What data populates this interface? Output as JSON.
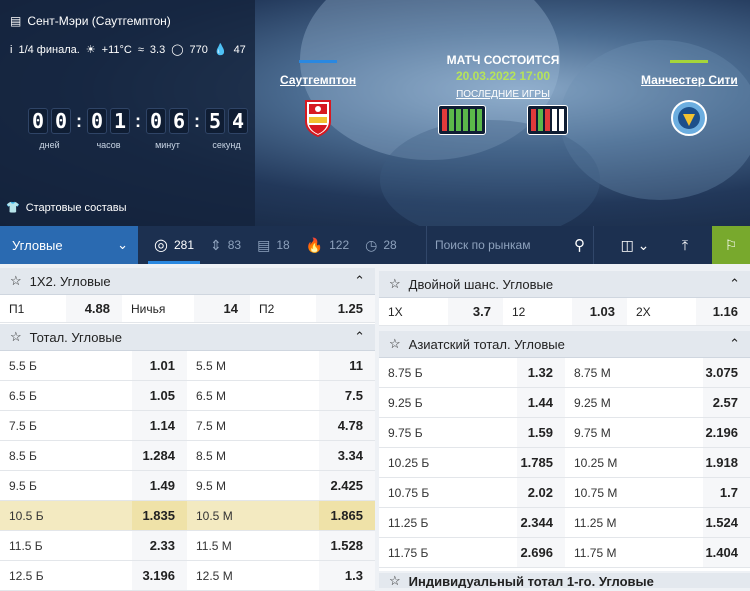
{
  "hero": {
    "venue": "Сент-Мэри (Саутгемптон)",
    "stage": "1/4 финала.",
    "temperature": "+11°C",
    "wind": "3.3",
    "attendance": "770",
    "humidity": "47",
    "countdown": {
      "days": [
        "0",
        "0"
      ],
      "hours": [
        "0",
        "1"
      ],
      "minutes": [
        "0",
        "6"
      ],
      "seconds": [
        "5",
        "4"
      ],
      "labels": {
        "days": "дней",
        "hours": "часов",
        "minutes": "минут",
        "seconds": "секунд"
      }
    },
    "lineups": "Стартовые составы",
    "home": {
      "name": "Саутгемптон",
      "bar_color": "#2a88e0"
    },
    "away": {
      "name": "Манчестер Сити",
      "bar_color": "#a5d53a"
    },
    "status": "МАТЧ СОСТОИТСЯ",
    "datetime": "20.03.2022 17:00",
    "last_games": "ПОСЛЕДНИЕ ИГРЫ",
    "home_form": [
      "#e03b3b",
      "#5bb84a",
      "#5bb84a",
      "#5bb84a",
      "#5bb84a",
      "#5bb84a"
    ],
    "away_form": [
      "#e03b3b",
      "#5bb84a",
      "#e03b3b",
      "#ffffff",
      "#ffffff"
    ]
  },
  "toolbar": {
    "market": "Угловые",
    "count_all": "281",
    "count_2": "83",
    "count_3": "18",
    "count_4": "122",
    "count_5": "28",
    "search_placeholder": "Поиск по рынкам"
  },
  "left": {
    "p1x2": {
      "title": "1Х2. Угловые",
      "cells": [
        {
          "label": "П1",
          "odd": "4.88"
        },
        {
          "label": "Ничья",
          "odd": "14"
        },
        {
          "label": "П2",
          "odd": "1.25"
        }
      ]
    },
    "total": {
      "title": "Тотал. Угловые",
      "rows": [
        {
          "a": "5.5 Б",
          "ao": "1.01",
          "b": "5.5 М",
          "bo": "11"
        },
        {
          "a": "6.5 Б",
          "ao": "1.05",
          "b": "6.5 М",
          "bo": "7.5"
        },
        {
          "a": "7.5 Б",
          "ao": "1.14",
          "b": "7.5 М",
          "bo": "4.78"
        },
        {
          "a": "8.5 Б",
          "ao": "1.284",
          "b": "8.5 М",
          "bo": "3.34"
        },
        {
          "a": "9.5 Б",
          "ao": "1.49",
          "b": "9.5 М",
          "bo": "2.425"
        },
        {
          "a": "10.5 Б",
          "ao": "1.835",
          "b": "10.5 М",
          "bo": "1.865"
        },
        {
          "a": "11.5 Б",
          "ao": "2.33",
          "b": "11.5 М",
          "bo": "1.528"
        },
        {
          "a": "12.5 Б",
          "ao": "3.196",
          "b": "12.5 М",
          "bo": "1.3"
        }
      ]
    }
  },
  "right": {
    "double": {
      "title": "Двойной шанс. Угловые",
      "cells": [
        {
          "label": "1Х",
          "odd": "3.7"
        },
        {
          "label": "12",
          "odd": "1.03"
        },
        {
          "label": "2Х",
          "odd": "1.16"
        }
      ]
    },
    "asian": {
      "title": "Азиатский тотал. Угловые",
      "rows": [
        {
          "a": "8.75 Б",
          "ao": "1.32",
          "b": "8.75 М",
          "bo": "3.075"
        },
        {
          "a": "9.25 Б",
          "ao": "1.44",
          "b": "9.25 М",
          "bo": "2.57"
        },
        {
          "a": "9.75 Б",
          "ao": "1.59",
          "b": "9.75 М",
          "bo": "2.196"
        },
        {
          "a": "10.25 Б",
          "ao": "1.785",
          "b": "10.25 М",
          "bo": "1.918"
        },
        {
          "a": "10.75 Б",
          "ao": "2.02",
          "b": "10.75 М",
          "bo": "1.7"
        },
        {
          "a": "11.25 Б",
          "ao": "2.344",
          "b": "11.25 М",
          "bo": "1.524"
        },
        {
          "a": "11.75 Б",
          "ao": "2.696",
          "b": "11.75 М",
          "bo": "1.404"
        }
      ]
    },
    "individual_title": "Индивидуальный тотал 1-го. Угловые"
  }
}
